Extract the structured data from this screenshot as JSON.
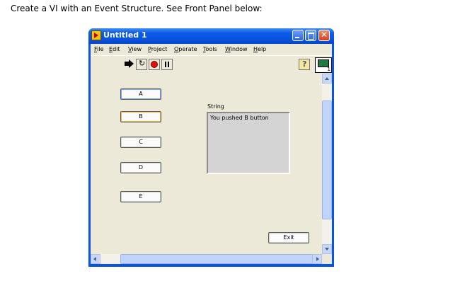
{
  "instruction": "Create a VI with an Event Structure. See Front Panel below:",
  "window": {
    "title": "Untitled 1"
  },
  "menubar": {
    "items": [
      {
        "accel": "F",
        "rest": "ile"
      },
      {
        "accel": "E",
        "rest": "dit"
      },
      {
        "accel": "V",
        "rest": "iew"
      },
      {
        "accel": "P",
        "rest": "roject"
      },
      {
        "accel": "O",
        "rest": "perate"
      },
      {
        "accel": "T",
        "rest": "ools"
      },
      {
        "accel": "W",
        "rest": "indow"
      },
      {
        "accel": "H",
        "rest": "elp"
      }
    ]
  },
  "connector_pane": {
    "number": "1"
  },
  "buttons": {
    "a": "A",
    "b": "B",
    "c": "C",
    "d": "D",
    "e": "E",
    "exit": "Exit"
  },
  "string_indicator": {
    "label": "String",
    "value": "You pushed B button"
  },
  "colors": {
    "titlebar": "#0a54e3",
    "panel": "#ece9d8",
    "string_bg": "#d4d4d4",
    "abort": "#e01010"
  }
}
